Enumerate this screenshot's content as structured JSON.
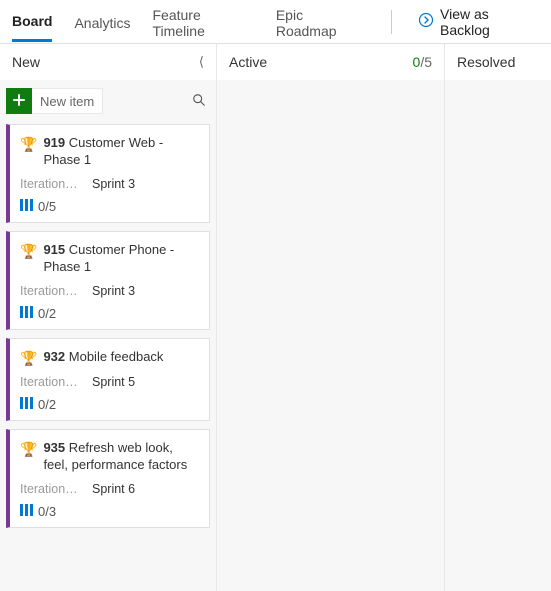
{
  "tabs": {
    "board": "Board",
    "analytics": "Analytics",
    "feature_timeline": "Feature Timeline",
    "epic_roadmap": "Epic Roadmap"
  },
  "view_backlog": "View as Backlog",
  "columns": {
    "new": {
      "title": "New"
    },
    "active": {
      "title": "Active",
      "wip_current": "0",
      "wip_limit": "/5"
    },
    "resolved": {
      "title": "Resolved"
    }
  },
  "new_item": {
    "label": "New item"
  },
  "cards": [
    {
      "id": "919",
      "title": "Customer Web - Phase 1",
      "field_label": "Iteration ...",
      "field_value": "Sprint 3",
      "progress": "0/5"
    },
    {
      "id": "915",
      "title": "Customer Phone - Phase 1",
      "field_label": "Iteration ...",
      "field_value": "Sprint 3",
      "progress": "0/2"
    },
    {
      "id": "932",
      "title": "Mobile feedback",
      "field_label": "Iteration ...",
      "field_value": "Sprint 5",
      "progress": "0/2"
    },
    {
      "id": "935",
      "title": "Refresh web look, feel, performance factors",
      "field_label": "Iteration ...",
      "field_value": "Sprint 6",
      "progress": "0/3"
    }
  ]
}
